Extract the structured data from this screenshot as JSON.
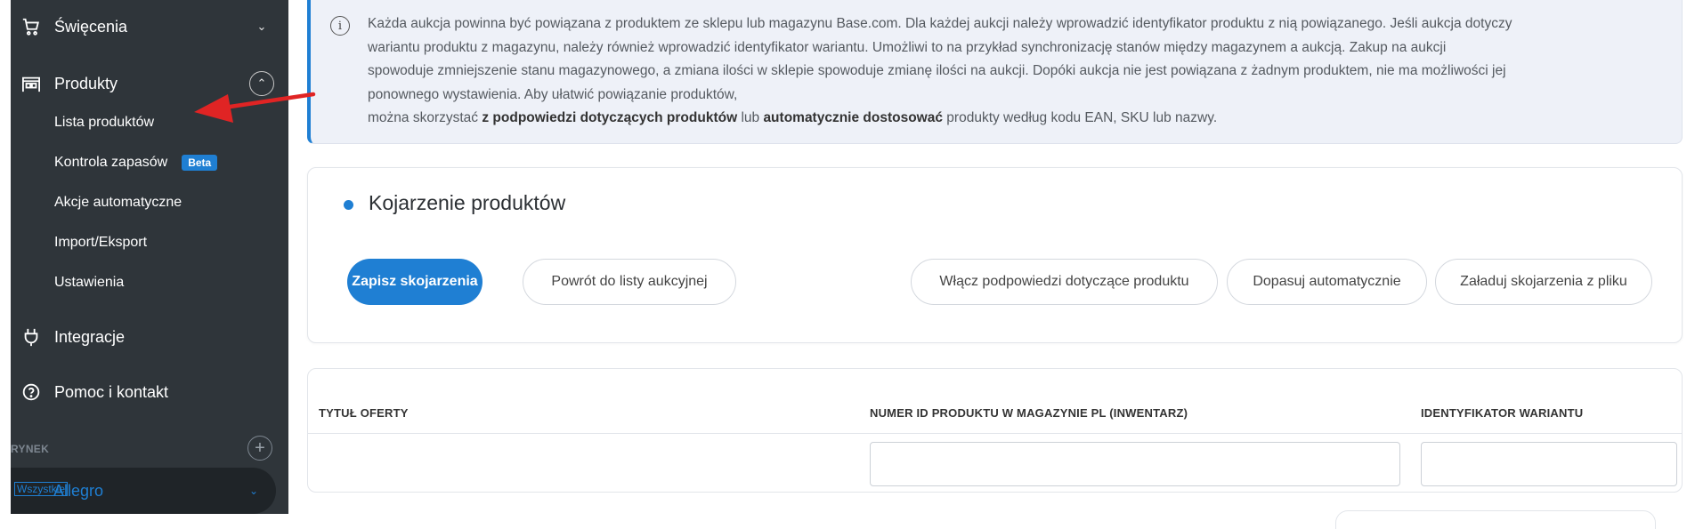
{
  "sidebar": {
    "nav": [
      {
        "label": "Święcenia",
        "icon": "cart-icon",
        "chevron": "chevron-down"
      },
      {
        "label": "Produkty",
        "icon": "warehouse-icon",
        "chevron": "chevron-up-circle"
      },
      {
        "label": "Integracje",
        "icon": "plug-icon"
      },
      {
        "label": "Pomoc i kontakt",
        "icon": "help-circle-icon"
      }
    ],
    "subitems": [
      {
        "label": "Lista produktów"
      },
      {
        "label": "Kontrola zapasów",
        "badge": "Beta"
      },
      {
        "label": "Akcje automatyczne"
      },
      {
        "label": "Import/Eksport"
      },
      {
        "label": "Ustawienia"
      }
    ],
    "market_section_label": "RYNEK",
    "market_select": {
      "value": "Allegro",
      "overlay": "Wszystkie"
    }
  },
  "info": {
    "line1": "Każda aukcja powinna być powiązana z produktem ze sklepu lub magazynu Base.com. Dla każdej aukcji należy wprowadzić identyfikator produktu z nią powiązanego. Jeśli aukcja dotyczy",
    "line2": "wariantu produktu z magazynu, należy również wprowadzić identyfikator wariantu. Umożliwi to na przykład synchronizację stanów między magazynem a aukcją. Zakup na aukcji",
    "line3": "spowoduje zmniejszenie stanu magazynowego, a zmiana ilości w sklepie spowoduje zmianę ilości na aukcji. Dopóki aukcja nie jest powiązana z żadnym produktem, nie ma możliwości jej",
    "line4": "ponownego wystawienia. Aby ułatwić powiązanie produktów,",
    "line5_pre": "można skorzystać",
    "line5_bold1": "z podpowiedzi dotyczących produktów",
    "line5_mid": "lub",
    "line5_bold2": "automatycznie dostosować",
    "line5_post": "produkty według kodu EAN, SKU lub nazwy."
  },
  "card": {
    "title": "Kojarzenie produktów",
    "buttons": {
      "save": "Zapisz skojarzenia",
      "back": "Powrót do listy aukcyjnej",
      "hints": "Włącz podpowiedzi dotyczące produktu",
      "auto": "Dopasuj automatycznie",
      "load": "Załaduj skojarzenia z pliku"
    }
  },
  "table": {
    "columns": [
      "TYTUŁ OFERTY",
      "NUMER ID PRODUKTU W MAGAZYNIE PL (INWENTARZ)",
      "IDENTYFIKATOR WARIANTU"
    ],
    "row": {
      "title": "",
      "product_id": "",
      "variant_id": ""
    }
  },
  "colors": {
    "accent": "#1f7fd3",
    "sidebar": "#2f353a",
    "arrow": "#e02424"
  }
}
